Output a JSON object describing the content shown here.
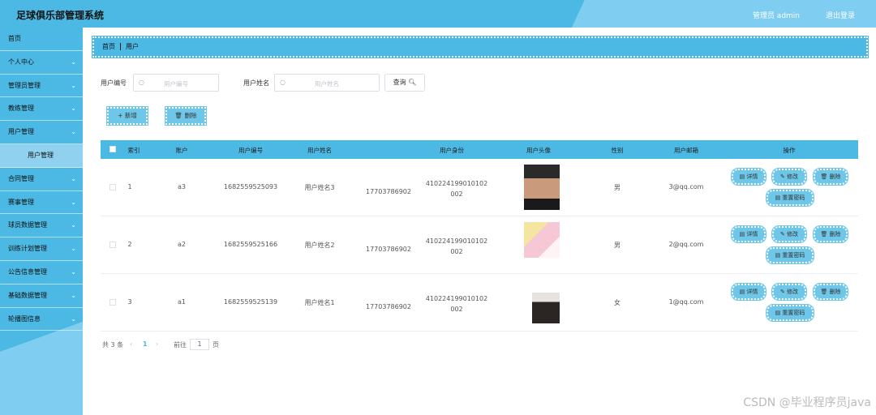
{
  "header": {
    "title": "足球俱乐部管理系统",
    "user": "管理员 admin",
    "logout": "退出登录"
  },
  "sidebar": {
    "items": [
      {
        "label": "首页",
        "chevron": false
      },
      {
        "label": "个人中心",
        "chevron": true
      },
      {
        "label": "管理员管理",
        "chevron": true
      },
      {
        "label": "教练管理",
        "chevron": true
      },
      {
        "label": "用户管理",
        "chevron": true
      },
      {
        "label": "用户管理",
        "chevron": false,
        "sub": true
      },
      {
        "label": "合同管理",
        "chevron": true
      },
      {
        "label": "赛事管理",
        "chevron": true
      },
      {
        "label": "球员数据管理",
        "chevron": true
      },
      {
        "label": "训练计划管理",
        "chevron": true
      },
      {
        "label": "公告信息管理",
        "chevron": true
      },
      {
        "label": "基础数据管理",
        "chevron": true
      },
      {
        "label": "轮播图信息",
        "chevron": true
      }
    ]
  },
  "breadcrumb": {
    "home": "首页",
    "current": "用户"
  },
  "search": {
    "label1": "用户编号",
    "placeholder1": "用户编号",
    "label2": "用户姓名",
    "placeholder2": "用户姓名",
    "button": "查询"
  },
  "actions": {
    "add": "+ 新增",
    "delete": "删除"
  },
  "table": {
    "headers": [
      "索引",
      "账户",
      "用户编号",
      "用户姓名",
      "用户身份",
      "用户头像",
      "性别",
      "用户邮箱",
      "操作"
    ],
    "rows": [
      {
        "index": "1",
        "account": "a3",
        "code": "1682559525093",
        "name": "用户姓名3",
        "phone": "17703786902",
        "id_a": "410224199010102",
        "id_b": "002",
        "gender": "男",
        "email": "3@qq.com"
      },
      {
        "index": "2",
        "account": "a2",
        "code": "1682559525166",
        "name": "用户姓名2",
        "phone": "17703786902",
        "id_a": "410224199010102",
        "id_b": "002",
        "gender": "男",
        "email": "2@qq.com"
      },
      {
        "index": "3",
        "account": "a1",
        "code": "1682559525139",
        "name": "用户姓名1",
        "phone": "17703786902",
        "id_a": "410224199010102",
        "id_b": "002",
        "gender": "女",
        "email": "1@qq.com"
      }
    ],
    "ops": {
      "detail": "详情",
      "edit": "修改",
      "delete": "删除",
      "reset": "重置密码"
    }
  },
  "pager": {
    "total": "共 3 条",
    "prev": "‹",
    "page": "1",
    "next": "›",
    "goto": "前往",
    "page_input": "1",
    "unit": "页"
  },
  "watermark": "CSDN @毕业程序员java",
  "colors": {
    "primary": "#4cb9e4",
    "button": "#6ec7e9"
  }
}
